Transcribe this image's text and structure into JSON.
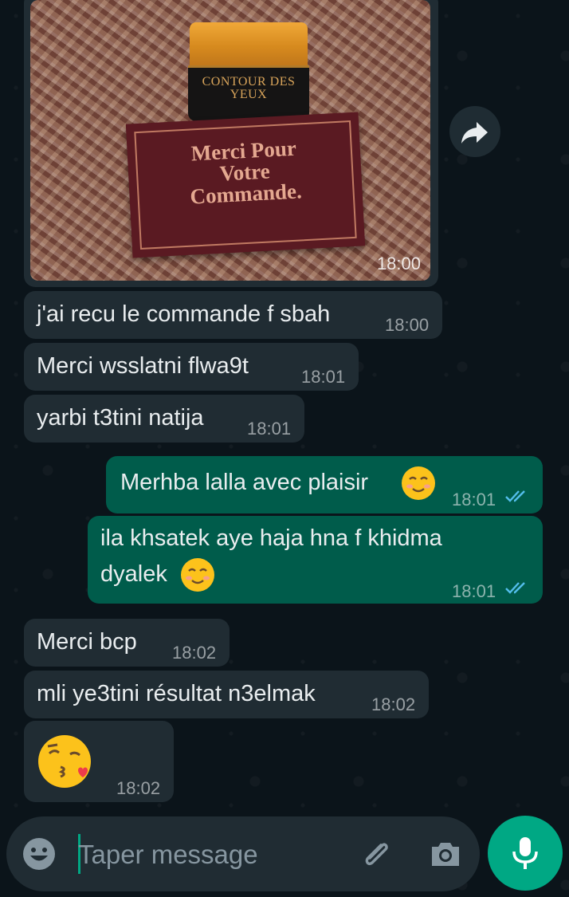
{
  "image_message": {
    "jar_label": "CONTOUR DES YEUX",
    "card_lines": [
      "Merci Pour",
      "Votre",
      "Commande."
    ],
    "time": "18:00"
  },
  "messages": [
    {
      "direction": "in",
      "text": "j'ai recu le commande f sbah",
      "time": "18:00"
    },
    {
      "direction": "in",
      "text": "Merci wsslatni flwa9t",
      "time": "18:01"
    },
    {
      "direction": "in",
      "text": "yarbi t3tini natija",
      "time": "18:01"
    },
    {
      "direction": "out",
      "text": "Merhba lalla avec plaisir",
      "emoji": "smiling-face",
      "time": "18:01",
      "status": "read"
    },
    {
      "direction": "out",
      "text_line1": "ila khsatek aye haja hna f khidma",
      "text_line2": "dyalek",
      "emoji": "smiling-face",
      "time": "18:01",
      "status": "read"
    },
    {
      "direction": "in",
      "text": "Merci bcp",
      "time": "18:02"
    },
    {
      "direction": "in",
      "text": "mli ye3tini résultat n3elmak",
      "time": "18:02"
    },
    {
      "direction": "in",
      "emoji": "face-blowing-a-kiss",
      "time": "18:02"
    }
  ],
  "composer": {
    "placeholder": "Taper message",
    "icons": [
      "emoji-icon",
      "attach-icon",
      "camera-icon",
      "mic-icon"
    ]
  },
  "colors": {
    "background": "#0b141a",
    "incoming_bubble": "#202c33",
    "outgoing_bubble": "#005c4b",
    "accent": "#00a884",
    "read_ticks": "#53bdeb"
  }
}
